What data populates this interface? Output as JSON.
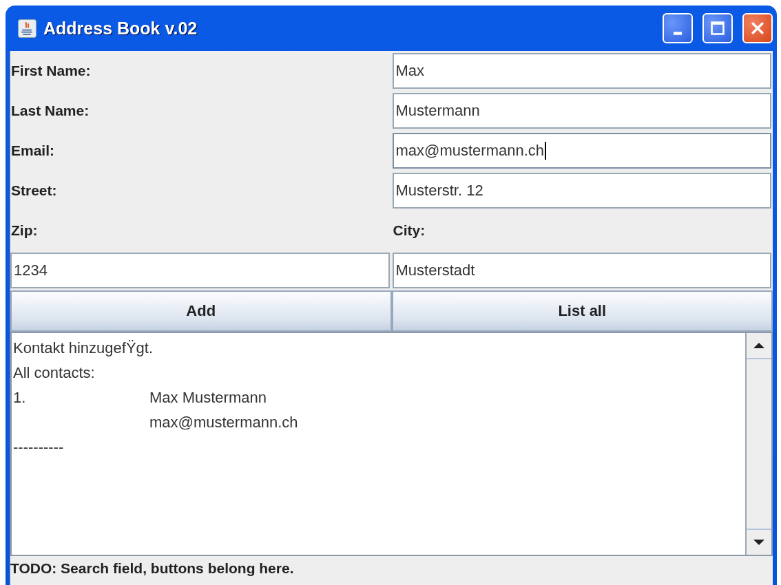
{
  "window": {
    "title": "Address Book v.02"
  },
  "form_rows": [
    {
      "label": "First Name:",
      "value": "Max",
      "focused": false
    },
    {
      "label": "Last Name:",
      "value": "Mustermann",
      "focused": false
    },
    {
      "label": "Email:",
      "value": "max@mustermann.ch",
      "focused": true
    },
    {
      "label": "Street:",
      "value": "Musterstr. 12",
      "focused": false
    }
  ],
  "zip": {
    "label": "Zip:",
    "value": "1234",
    "focused": false
  },
  "city": {
    "label": "City:",
    "value": "Musterstadt",
    "focused": false
  },
  "buttons": [
    "Add",
    "List all"
  ],
  "output_lines": [
    {
      "kind": "plain",
      "text": "Kontakt hinzugefŸgt."
    },
    {
      "kind": "plain",
      "text": "All contacts:"
    },
    {
      "kind": "entry",
      "number": "1.",
      "text": "Max Mustermann"
    },
    {
      "kind": "indent",
      "text": "max@mustermann.ch"
    },
    {
      "kind": "plain",
      "text": "----------"
    }
  ],
  "status_bar": "TODO: Search field, buttons belong here."
}
